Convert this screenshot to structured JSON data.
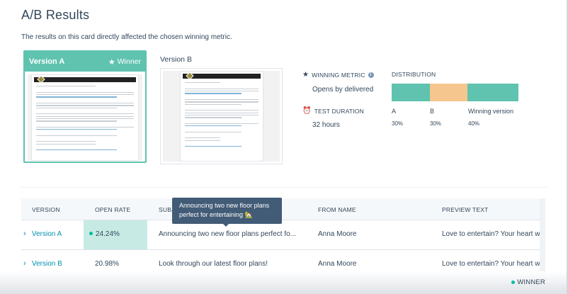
{
  "page": {
    "title": "A/B Results",
    "subtitle": "The results on this card directly affected the chosen winning metric."
  },
  "versions": {
    "a": {
      "label": "Version A",
      "badge": "Winner"
    },
    "b": {
      "label": "Version B"
    }
  },
  "metrics": {
    "winning_metric_label": "WINNING METRIC",
    "winning_metric_value": "Opens by delivered",
    "test_duration_label": "TEST DURATION",
    "test_duration_value": "32 hours"
  },
  "distribution": {
    "label": "DISTRIBUTION",
    "segments": [
      {
        "name": "A",
        "percent": "30%",
        "share": 30,
        "color": "#5fc3af"
      },
      {
        "name": "B",
        "percent": "30%",
        "share": 30,
        "color": "#f5c78e"
      },
      {
        "name": "Winning version",
        "percent": "40%",
        "share": 40,
        "color": "#5fc3af"
      }
    ]
  },
  "table": {
    "headers": [
      "VERSION",
      "OPEN RATE",
      "SUBJ",
      "FROM NAME",
      "PREVIEW TEXT"
    ],
    "rows": [
      {
        "version": "Version A",
        "open_rate": "24.24%",
        "subject": "Announcing two new floor plans perfect fo...",
        "from_name": "Anna Moore",
        "preview": "Love to entertain? Your heart will be"
      },
      {
        "version": "Version B",
        "open_rate": "20.98%",
        "subject": "Look through our latest floor plans!",
        "from_name": "Anna Moore",
        "preview": "Love to entertain? Your heart will be"
      }
    ]
  },
  "tooltip": {
    "text": "Announcing two new floor plans perfect for entertaining 🏡"
  },
  "legend": {
    "label": "WINNER",
    "color": "#00bda5"
  },
  "icons": {
    "winner": "star-icon",
    "winning_metric": "star-icon",
    "info": "info-icon",
    "test_duration": "clock-icon",
    "row_expand": "chevron-right-icon"
  }
}
